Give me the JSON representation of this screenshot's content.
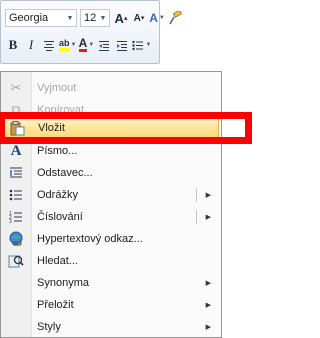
{
  "toolbar": {
    "font_name": "Georgia",
    "font_size": "12",
    "grow_font": "A",
    "shrink_font": "A",
    "bold": "B",
    "italic": "I"
  },
  "menu": {
    "items": [
      {
        "label": "Vyjmout",
        "enabled": false
      },
      {
        "label": "Kopírovat",
        "enabled": false
      },
      {
        "label": "Vložit",
        "enabled": true,
        "highlighted": true
      },
      {
        "label": "Písmo...",
        "enabled": true
      },
      {
        "label": "Odstavec...",
        "enabled": true
      },
      {
        "label": "Odrážky",
        "enabled": true,
        "submenu": true
      },
      {
        "label": "Číslování",
        "enabled": true,
        "submenu": true
      },
      {
        "label": "Hypertextový odkaz...",
        "enabled": true
      },
      {
        "label": "Hledat...",
        "enabled": true
      },
      {
        "label": "Synonyma",
        "enabled": true,
        "submenu": true
      },
      {
        "label": "Přeložit",
        "enabled": true,
        "submenu": true
      },
      {
        "label": "Styly",
        "enabled": true,
        "submenu": true
      }
    ]
  },
  "colors": {
    "highlight_start": "#fff3cd",
    "highlight_end": "#ffd970",
    "callout": "#ff0000"
  }
}
